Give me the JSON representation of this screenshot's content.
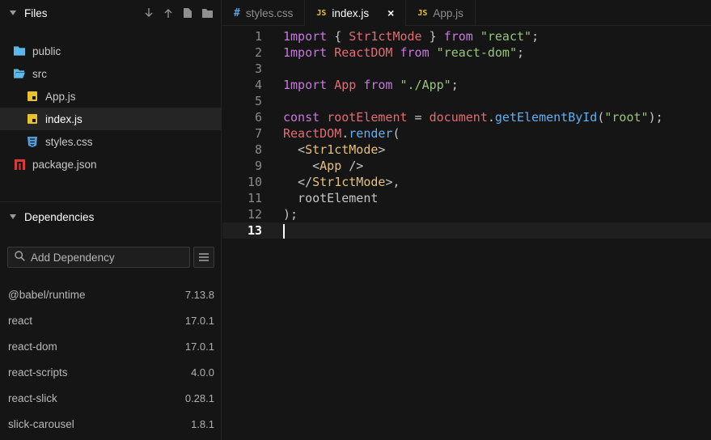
{
  "sidebar": {
    "files_title": "Files",
    "tree": [
      {
        "name": "public",
        "icon": "folder-icon",
        "level": 0,
        "selected": false
      },
      {
        "name": "src",
        "icon": "folder-open-icon",
        "level": 0,
        "selected": false
      },
      {
        "name": "App.js",
        "icon": "js-file-icon",
        "level": 1,
        "selected": false
      },
      {
        "name": "index.js",
        "icon": "js-file-icon",
        "level": 1,
        "selected": true
      },
      {
        "name": "styles.css",
        "icon": "css-file-icon",
        "level": 1,
        "selected": false
      },
      {
        "name": "package.json",
        "icon": "npm-icon",
        "level": 0,
        "selected": false
      }
    ],
    "dependencies_title": "Dependencies",
    "dep_search_placeholder": "Add Dependency",
    "dependencies": [
      {
        "name": "@babel/runtime",
        "version": "7.13.8"
      },
      {
        "name": "react",
        "version": "17.0.1"
      },
      {
        "name": "react-dom",
        "version": "17.0.1"
      },
      {
        "name": "react-scripts",
        "version": "4.0.0"
      },
      {
        "name": "react-slick",
        "version": "0.28.1"
      },
      {
        "name": "slick-carousel",
        "version": "1.8.1"
      }
    ]
  },
  "tabs": [
    {
      "label": "styles.css",
      "icon_text": "#",
      "kind": "css",
      "active": false,
      "closable": false
    },
    {
      "label": "index.js",
      "icon_text": "JS",
      "kind": "js",
      "active": true,
      "closable": true
    },
    {
      "label": "App.js",
      "icon_text": "JS",
      "kind": "js",
      "active": false,
      "closable": false
    }
  ],
  "tab_close_glyph": "×",
  "code_lines": [
    [
      [
        "kw",
        "1mport"
      ],
      [
        "pl",
        " { "
      ],
      [
        "id",
        "Str1ctMode"
      ],
      [
        "pl",
        " } "
      ],
      [
        "kw",
        "from"
      ],
      [
        "pl",
        " "
      ],
      [
        "str",
        "\"react\""
      ],
      [
        "pl",
        ";"
      ]
    ],
    [
      [
        "kw",
        "1mport"
      ],
      [
        "pl",
        " "
      ],
      [
        "id",
        "ReactDOM"
      ],
      [
        "pl",
        " "
      ],
      [
        "kw",
        "from"
      ],
      [
        "pl",
        " "
      ],
      [
        "str",
        "\"react-dom\""
      ],
      [
        "pl",
        ";"
      ]
    ],
    [],
    [
      [
        "kw",
        "1mport"
      ],
      [
        "pl",
        " "
      ],
      [
        "id",
        "App"
      ],
      [
        "pl",
        " "
      ],
      [
        "kw",
        "from"
      ],
      [
        "pl",
        " "
      ],
      [
        "str",
        "\"./App\""
      ],
      [
        "pl",
        ";"
      ]
    ],
    [],
    [
      [
        "kw",
        "const"
      ],
      [
        "pl",
        " "
      ],
      [
        "id",
        "rootElement"
      ],
      [
        "pl",
        " = "
      ],
      [
        "id",
        "document"
      ],
      [
        "pl",
        "."
      ],
      [
        "fn",
        "getElementById"
      ],
      [
        "pl",
        "("
      ],
      [
        "str",
        "\"root\""
      ],
      [
        "pl",
        ");"
      ]
    ],
    [
      [
        "id",
        "ReactDOM"
      ],
      [
        "pl",
        "."
      ],
      [
        "fn",
        "render"
      ],
      [
        "pl",
        "("
      ]
    ],
    [
      [
        "pl",
        "  <"
      ],
      [
        "tag",
        "Str1ctMode"
      ],
      [
        "pl",
        ">"
      ]
    ],
    [
      [
        "pl",
        "    <"
      ],
      [
        "tag",
        "App"
      ],
      [
        "pl",
        " />"
      ]
    ],
    [
      [
        "pl",
        "  </"
      ],
      [
        "tag",
        "Str1ctMode"
      ],
      [
        "pl",
        ">,"
      ]
    ],
    [
      [
        "pl",
        "  rootElement"
      ]
    ],
    [
      [
        "pl",
        ");"
      ]
    ],
    []
  ],
  "current_line": 13
}
